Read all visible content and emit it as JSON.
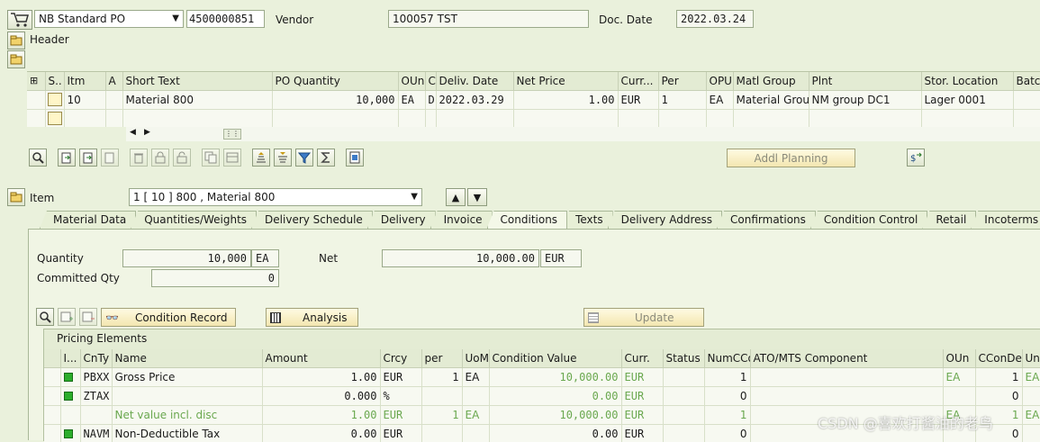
{
  "header": {
    "doc_type": "NB Standard PO",
    "po_number": "4500000851",
    "vendor_label": "Vendor",
    "vendor_value": "100057 TST",
    "doc_date_label": "Doc. Date",
    "doc_date_value": "2022.03.24",
    "header_label": "Header"
  },
  "items_grid": {
    "columns": [
      "S..",
      "Itm",
      "A",
      "Short Text",
      "PO Quantity",
      "OUn",
      "C",
      "Deliv. Date",
      "Net Price",
      "Curr...",
      "Per",
      "OPU",
      "Matl Group",
      "Plnt",
      "Stor. Location",
      "Batch"
    ],
    "rows": [
      {
        "itm": "10",
        "a": "",
        "short_text": "Material 800",
        "po_qty": "10,000",
        "oun": "EA",
        "c": "D",
        "deliv_date": "2022.03.29",
        "net_price": "1.00",
        "curr": "EUR",
        "per": "1",
        "opu": "EA",
        "matl_group": "Material Group...",
        "plnt": "NM group DC1",
        "stor_loc": "Lager 0001",
        "batch": ""
      }
    ]
  },
  "toolbar": {
    "addl_planning": "Addl Planning"
  },
  "item_nav": {
    "label": "Item",
    "selected": "1 [ 10 ] 800 , Material 800"
  },
  "tabs": [
    "Material Data",
    "Quantities/Weights",
    "Delivery Schedule",
    "Delivery",
    "Invoice",
    "Conditions",
    "Texts",
    "Delivery Address",
    "Confirmations",
    "Condition Control",
    "Retail",
    "Incoterms"
  ],
  "active_tab": "Conditions",
  "conditions": {
    "quantity_label": "Quantity",
    "quantity_value": "10,000",
    "quantity_unit": "EA",
    "net_label": "Net",
    "net_value": "10,000.00",
    "net_curr": "EUR",
    "committed_label": "Committed Qty",
    "committed_value": "0",
    "condition_record_btn": "Condition Record",
    "analysis_btn": "Analysis",
    "update_btn": "Update",
    "pricing_title": "Pricing Elements",
    "pricing_columns": [
      "I...",
      "CnTy",
      "Name",
      "Amount",
      "Crcy",
      "per",
      "UoM",
      "Condition Value",
      "Curr.",
      "Status",
      "NumCCo",
      "ATO/MTS Component",
      "OUn",
      "CConDe",
      "Un"
    ],
    "pricing_rows": [
      {
        "status_icon": true,
        "cnty": "PBXX",
        "name": "Gross Price",
        "amount": "1.00",
        "crcy": "EUR",
        "per": "1",
        "uom": "EA",
        "cond_value": "10,000.00",
        "curr": "EUR",
        "status": "",
        "numcco": "1",
        "ato": "",
        "oun": "EA",
        "ccon": "1",
        "un": "EA",
        "style": "normal"
      },
      {
        "status_icon": true,
        "cnty": "ZTAX",
        "name": "",
        "amount": "0.000",
        "crcy": "%",
        "per": "",
        "uom": "",
        "cond_value": "0.00",
        "curr": "EUR",
        "status": "",
        "numcco": "0",
        "ato": "",
        "oun": "",
        "ccon": "0",
        "un": "",
        "style": "normal"
      },
      {
        "status_icon": false,
        "cnty": "",
        "name": "Net value incl. disc",
        "amount": "1.00",
        "crcy": "EUR",
        "per": "1",
        "uom": "EA",
        "cond_value": "10,000.00",
        "curr": "EUR",
        "status": "",
        "numcco": "1",
        "ato": "",
        "oun": "EA",
        "ccon": "1",
        "un": "EA",
        "style": "subtotal"
      },
      {
        "status_icon": true,
        "cnty": "NAVM",
        "name": "Non-Deductible Tax",
        "amount": "0.00",
        "crcy": "EUR",
        "per": "",
        "uom": "",
        "cond_value": "0.00",
        "curr": "EUR",
        "status": "",
        "numcco": "0",
        "ato": "",
        "oun": "",
        "ccon": "0",
        "un": "",
        "style": "normal"
      }
    ]
  },
  "watermark": "CSDN @喜欢打酱油的老鸟"
}
